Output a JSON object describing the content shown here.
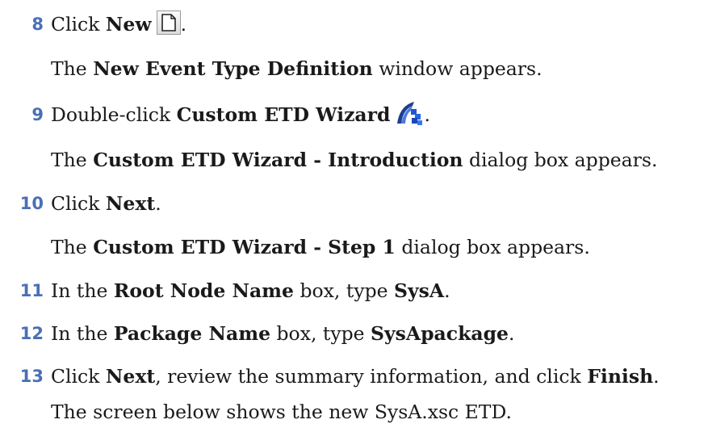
{
  "steps": [
    {
      "num": "8",
      "pre": "Click ",
      "bold1": "New",
      "post": "",
      "icon": "new-document-icon",
      "end": ".",
      "result": {
        "pre": "The ",
        "bold": "New Event Type Definition",
        "post": " window appears."
      }
    },
    {
      "num": "9",
      "pre": "Double-click ",
      "bold1": "Custom ETD Wizard",
      "icon": "custom-etd-wizard-icon",
      "end": ".",
      "result": {
        "pre": "The ",
        "bold": "Custom ETD Wizard - Introduction",
        "post": " dialog box appears."
      }
    },
    {
      "num": "10",
      "pre": "Click ",
      "bold1": "Next",
      "end": ".",
      "result": {
        "pre": "The ",
        "bold": "Custom ETD Wizard - Step 1",
        "post": " dialog box appears."
      }
    },
    {
      "num": "11",
      "pre": "In the ",
      "bold1": "Root Node Name",
      "mid": " box, type ",
      "bold2": "SysA",
      "end": "."
    },
    {
      "num": "12",
      "pre": "In the ",
      "bold1": "Package Name",
      "mid": " box, type ",
      "bold2": "SysApackage",
      "end": "."
    },
    {
      "num": "13",
      "pre": "Click ",
      "bold1": "Next",
      "mid": ", review the summary information, and click ",
      "bold2": "Finish",
      "end": ".",
      "result": {
        "pre": "The screen below shows the new SysA.xsc ETD.",
        "bold": "",
        "post": ""
      }
    }
  ],
  "colors": {
    "step_number": "#4a6fb5",
    "text": "#1a1a1a"
  }
}
